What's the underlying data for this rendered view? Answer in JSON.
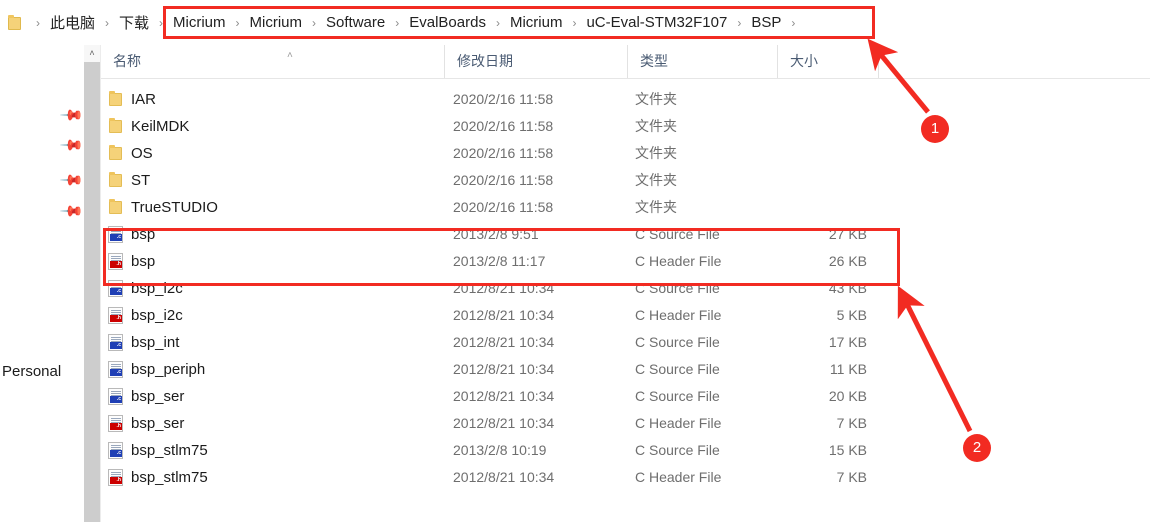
{
  "window": {
    "address_bar": {
      "folder_icon": "folder-icon",
      "crumbs": [
        {
          "label": "此电脑"
        },
        {
          "label": "下载"
        },
        {
          "label": "Micrium"
        },
        {
          "label": "Micrium"
        },
        {
          "label": "Software"
        },
        {
          "label": "EvalBoards"
        },
        {
          "label": "Micrium"
        },
        {
          "label": "uC-Eval-STM32F107"
        },
        {
          "label": "BSP"
        }
      ],
      "separator": "›"
    }
  },
  "sidebar": {
    "personal_label": "Personal",
    "pin_icon": "pin-icon",
    "pin_count": 4
  },
  "scrollbar": {
    "up_arrow": "˄"
  },
  "file_list": {
    "columns": [
      {
        "key": "name",
        "label": "名称"
      },
      {
        "key": "date",
        "label": "修改日期"
      },
      {
        "key": "type",
        "label": "类型"
      },
      {
        "key": "size",
        "label": "大小"
      }
    ],
    "sort_caret": "˄",
    "rows": [
      {
        "icon": "folder-icon",
        "name": "IAR",
        "date": "2020/2/16 11:58",
        "type": "文件夹",
        "size": ""
      },
      {
        "icon": "folder-icon",
        "name": "KeilMDK",
        "date": "2020/2/16 11:58",
        "type": "文件夹",
        "size": ""
      },
      {
        "icon": "folder-icon",
        "name": "OS",
        "date": "2020/2/16 11:58",
        "type": "文件夹",
        "size": ""
      },
      {
        "icon": "folder-icon",
        "name": "ST",
        "date": "2020/2/16 11:58",
        "type": "文件夹",
        "size": ""
      },
      {
        "icon": "folder-icon",
        "name": "TrueSTUDIO",
        "date": "2020/2/16 11:58",
        "type": "文件夹",
        "size": ""
      },
      {
        "icon": "c-source-icon",
        "name": "bsp",
        "date": "2013/2/8 9:51",
        "type": "C Source File",
        "size": "27 KB"
      },
      {
        "icon": "c-header-icon",
        "name": "bsp",
        "date": "2013/2/8 11:17",
        "type": "C Header File",
        "size": "26 KB"
      },
      {
        "icon": "c-source-icon",
        "name": "bsp_i2c",
        "date": "2012/8/21 10:34",
        "type": "C Source File",
        "size": "43 KB"
      },
      {
        "icon": "c-header-icon",
        "name": "bsp_i2c",
        "date": "2012/8/21 10:34",
        "type": "C Header File",
        "size": "5 KB"
      },
      {
        "icon": "c-source-icon",
        "name": "bsp_int",
        "date": "2012/8/21 10:34",
        "type": "C Source File",
        "size": "17 KB"
      },
      {
        "icon": "c-source-icon",
        "name": "bsp_periph",
        "date": "2012/8/21 10:34",
        "type": "C Source File",
        "size": "11 KB"
      },
      {
        "icon": "c-source-icon",
        "name": "bsp_ser",
        "date": "2012/8/21 10:34",
        "type": "C Source File",
        "size": "20 KB"
      },
      {
        "icon": "c-header-icon",
        "name": "bsp_ser",
        "date": "2012/8/21 10:34",
        "type": "C Header File",
        "size": "7 KB"
      },
      {
        "icon": "c-source-icon",
        "name": "bsp_stlm75",
        "date": "2013/2/8 10:19",
        "type": "C Source File",
        "size": "15 KB"
      },
      {
        "icon": "c-header-icon",
        "name": "bsp_stlm75",
        "date": "2012/8/21 10:34",
        "type": "C Header File",
        "size": "7 KB"
      }
    ]
  },
  "annotations": {
    "accent_color": "#f22b22",
    "markers": [
      {
        "label": "1"
      },
      {
        "label": "2"
      }
    ]
  }
}
